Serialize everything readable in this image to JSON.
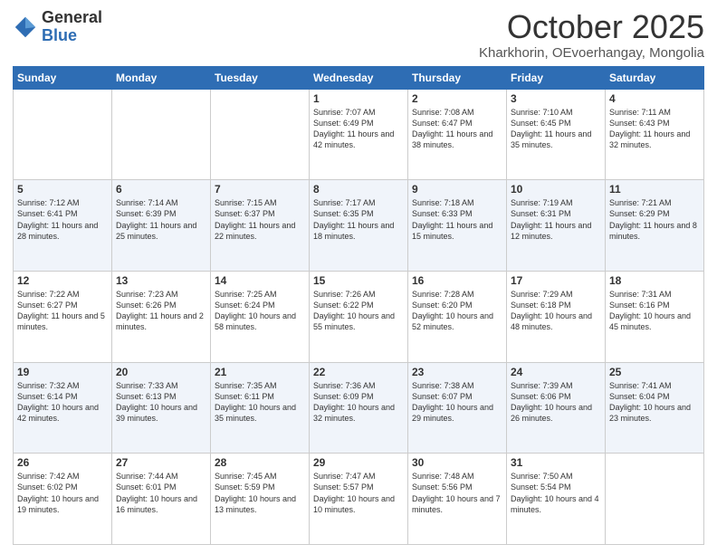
{
  "logo": {
    "general": "General",
    "blue": "Blue"
  },
  "header": {
    "month": "October 2025",
    "location": "Kharkhorin, OEvoerhangay, Mongolia"
  },
  "weekdays": [
    "Sunday",
    "Monday",
    "Tuesday",
    "Wednesday",
    "Thursday",
    "Friday",
    "Saturday"
  ],
  "weeks": [
    [
      {
        "day": "",
        "info": ""
      },
      {
        "day": "",
        "info": ""
      },
      {
        "day": "",
        "info": ""
      },
      {
        "day": "1",
        "info": "Sunrise: 7:07 AM\nSunset: 6:49 PM\nDaylight: 11 hours\nand 42 minutes."
      },
      {
        "day": "2",
        "info": "Sunrise: 7:08 AM\nSunset: 6:47 PM\nDaylight: 11 hours\nand 38 minutes."
      },
      {
        "day": "3",
        "info": "Sunrise: 7:10 AM\nSunset: 6:45 PM\nDaylight: 11 hours\nand 35 minutes."
      },
      {
        "day": "4",
        "info": "Sunrise: 7:11 AM\nSunset: 6:43 PM\nDaylight: 11 hours\nand 32 minutes."
      }
    ],
    [
      {
        "day": "5",
        "info": "Sunrise: 7:12 AM\nSunset: 6:41 PM\nDaylight: 11 hours\nand 28 minutes."
      },
      {
        "day": "6",
        "info": "Sunrise: 7:14 AM\nSunset: 6:39 PM\nDaylight: 11 hours\nand 25 minutes."
      },
      {
        "day": "7",
        "info": "Sunrise: 7:15 AM\nSunset: 6:37 PM\nDaylight: 11 hours\nand 22 minutes."
      },
      {
        "day": "8",
        "info": "Sunrise: 7:17 AM\nSunset: 6:35 PM\nDaylight: 11 hours\nand 18 minutes."
      },
      {
        "day": "9",
        "info": "Sunrise: 7:18 AM\nSunset: 6:33 PM\nDaylight: 11 hours\nand 15 minutes."
      },
      {
        "day": "10",
        "info": "Sunrise: 7:19 AM\nSunset: 6:31 PM\nDaylight: 11 hours\nand 12 minutes."
      },
      {
        "day": "11",
        "info": "Sunrise: 7:21 AM\nSunset: 6:29 PM\nDaylight: 11 hours\nand 8 minutes."
      }
    ],
    [
      {
        "day": "12",
        "info": "Sunrise: 7:22 AM\nSunset: 6:27 PM\nDaylight: 11 hours\nand 5 minutes."
      },
      {
        "day": "13",
        "info": "Sunrise: 7:23 AM\nSunset: 6:26 PM\nDaylight: 11 hours\nand 2 minutes."
      },
      {
        "day": "14",
        "info": "Sunrise: 7:25 AM\nSunset: 6:24 PM\nDaylight: 10 hours\nand 58 minutes."
      },
      {
        "day": "15",
        "info": "Sunrise: 7:26 AM\nSunset: 6:22 PM\nDaylight: 10 hours\nand 55 minutes."
      },
      {
        "day": "16",
        "info": "Sunrise: 7:28 AM\nSunset: 6:20 PM\nDaylight: 10 hours\nand 52 minutes."
      },
      {
        "day": "17",
        "info": "Sunrise: 7:29 AM\nSunset: 6:18 PM\nDaylight: 10 hours\nand 48 minutes."
      },
      {
        "day": "18",
        "info": "Sunrise: 7:31 AM\nSunset: 6:16 PM\nDaylight: 10 hours\nand 45 minutes."
      }
    ],
    [
      {
        "day": "19",
        "info": "Sunrise: 7:32 AM\nSunset: 6:14 PM\nDaylight: 10 hours\nand 42 minutes."
      },
      {
        "day": "20",
        "info": "Sunrise: 7:33 AM\nSunset: 6:13 PM\nDaylight: 10 hours\nand 39 minutes."
      },
      {
        "day": "21",
        "info": "Sunrise: 7:35 AM\nSunset: 6:11 PM\nDaylight: 10 hours\nand 35 minutes."
      },
      {
        "day": "22",
        "info": "Sunrise: 7:36 AM\nSunset: 6:09 PM\nDaylight: 10 hours\nand 32 minutes."
      },
      {
        "day": "23",
        "info": "Sunrise: 7:38 AM\nSunset: 6:07 PM\nDaylight: 10 hours\nand 29 minutes."
      },
      {
        "day": "24",
        "info": "Sunrise: 7:39 AM\nSunset: 6:06 PM\nDaylight: 10 hours\nand 26 minutes."
      },
      {
        "day": "25",
        "info": "Sunrise: 7:41 AM\nSunset: 6:04 PM\nDaylight: 10 hours\nand 23 minutes."
      }
    ],
    [
      {
        "day": "26",
        "info": "Sunrise: 7:42 AM\nSunset: 6:02 PM\nDaylight: 10 hours\nand 19 minutes."
      },
      {
        "day": "27",
        "info": "Sunrise: 7:44 AM\nSunset: 6:01 PM\nDaylight: 10 hours\nand 16 minutes."
      },
      {
        "day": "28",
        "info": "Sunrise: 7:45 AM\nSunset: 5:59 PM\nDaylight: 10 hours\nand 13 minutes."
      },
      {
        "day": "29",
        "info": "Sunrise: 7:47 AM\nSunset: 5:57 PM\nDaylight: 10 hours\nand 10 minutes."
      },
      {
        "day": "30",
        "info": "Sunrise: 7:48 AM\nSunset: 5:56 PM\nDaylight: 10 hours\nand 7 minutes."
      },
      {
        "day": "31",
        "info": "Sunrise: 7:50 AM\nSunset: 5:54 PM\nDaylight: 10 hours\nand 4 minutes."
      },
      {
        "day": "",
        "info": ""
      }
    ]
  ]
}
